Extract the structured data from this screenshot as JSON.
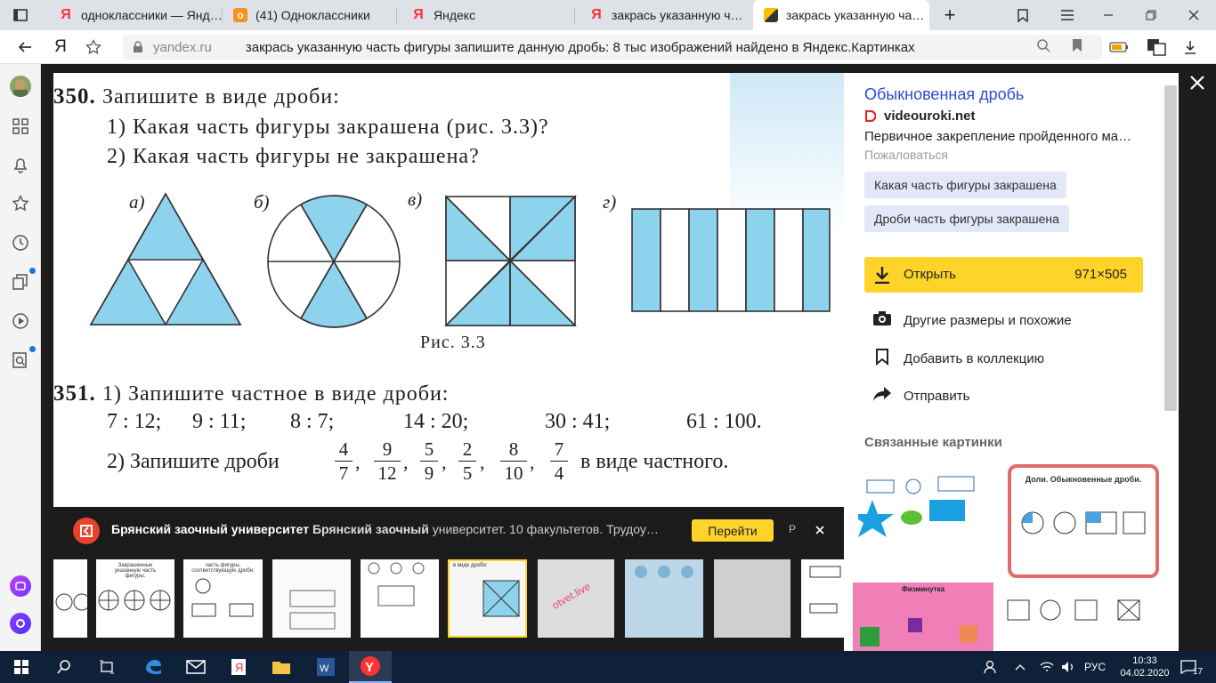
{
  "browser": {
    "tabs": [
      {
        "label": "одноклассники — Яндекс",
        "icon": "yandex-icon",
        "active": false
      },
      {
        "label": "(41) Одноклассники",
        "icon": "ok-icon",
        "active": false
      },
      {
        "label": "Яндекс",
        "icon": "yandex-icon",
        "active": false
      },
      {
        "label": "закрась указанную часть ф",
        "icon": "yandex-icon",
        "active": false
      },
      {
        "label": "закрась указанную часть ф",
        "icon": "images-icon",
        "active": true
      }
    ],
    "address": {
      "domain": "yandex.ru",
      "title": "закрась указанную часть фигуры запишите данную дробь: 8 тыс изображений найдено в Яндекс.Картинках"
    },
    "yandex_letter": "Я"
  },
  "page": {
    "problem_350": {
      "number": "350.",
      "heading": "Запишите в виде дроби:",
      "q1": "1) Какая часть фигуры закрашена (рис. 3.3)?",
      "q2": "2) Какая часть фигуры не закрашена?",
      "labels": [
        "а)",
        "б)",
        "в)",
        "г)"
      ],
      "caption": "Рис. 3.3"
    },
    "problem_351": {
      "number": "351.",
      "heading": "1) Запишите частное в виде дроби:",
      "quotients": [
        "7 : 12;",
        "9 : 11;",
        "8 : 7;",
        "14 : 20;",
        "30 : 41;",
        "61 : 100."
      ],
      "part2_prefix": "2) Запишите дроби",
      "fractions": [
        {
          "num": "4",
          "den": "7"
        },
        {
          "num": "9",
          "den": "12"
        },
        {
          "num": "5",
          "den": "9"
        },
        {
          "num": "2",
          "den": "5"
        },
        {
          "num": "8",
          "den": "10"
        },
        {
          "num": "7",
          "den": "4"
        }
      ],
      "part2_suffix": "в виде частного."
    }
  },
  "panel": {
    "title": "Обыкновенная дробь",
    "source": "videouroki.net",
    "description": "Первичное закрепление пройденного ма…",
    "complain": "Пожаловаться",
    "tags": [
      "Какая часть фигуры закрашена",
      "Дроби часть фигуры закрашена"
    ],
    "open_label": "Открыть",
    "open_size": "971×505",
    "actions": [
      "Другие размеры и похожие",
      "Добавить в коллекцию",
      "Отправить"
    ],
    "related_title": "Связанные картинки",
    "related": [
      {
        "title": "Доли. Обыкновенные дроби."
      },
      {
        "title": "Физминутка"
      }
    ]
  },
  "ad": {
    "brand": "Брянский заочный университет",
    "bold_part": "Брянский заочный",
    "text": "университет. 10 факультетов. Трудоу…",
    "button": "Перейти",
    "marker": "Р"
  },
  "thumb_text": {
    "t2": "Закрашенные указанную часть фигуры.",
    "t3": "часть фигуры, соответствующую дроби:",
    "t6": "в виде дроби:",
    "t7": "otvet.live"
  },
  "taskbar": {
    "lang": "РУС",
    "time": "10:33",
    "date": "04.02.2020",
    "notif": "17"
  },
  "colors": {
    "fill": "#8dd3ee",
    "accent": "#fed42b",
    "link": "#2a4dd0"
  }
}
